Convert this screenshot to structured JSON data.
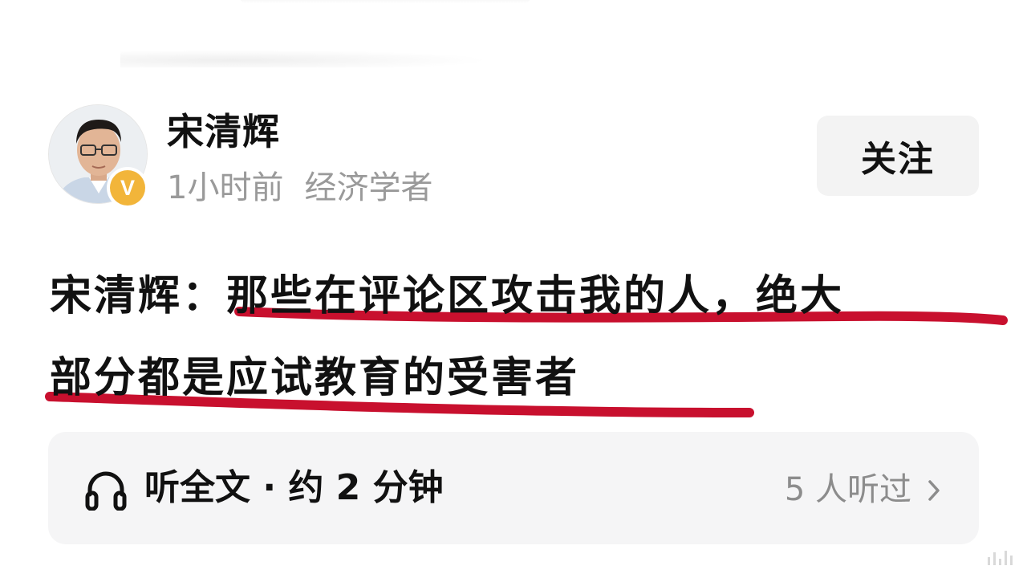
{
  "author": {
    "name": "宋清辉",
    "time": "1小时前",
    "title": "经济学者",
    "verified_badge": "V",
    "verified_color": "#f2b53a"
  },
  "follow_button": {
    "label": "关注"
  },
  "post": {
    "line1_prefix": "宋清辉：",
    "line1_highlight": "那些在评论区攻击我的人，绝大",
    "line2": "部分都是应试教育的受害者",
    "underline_color": "#c8102e"
  },
  "audio": {
    "icon": "headphone-icon",
    "label": "听全文 · 约 2 分钟",
    "listen_count": "5 人听过",
    "chevron": "chevron-right-icon"
  }
}
